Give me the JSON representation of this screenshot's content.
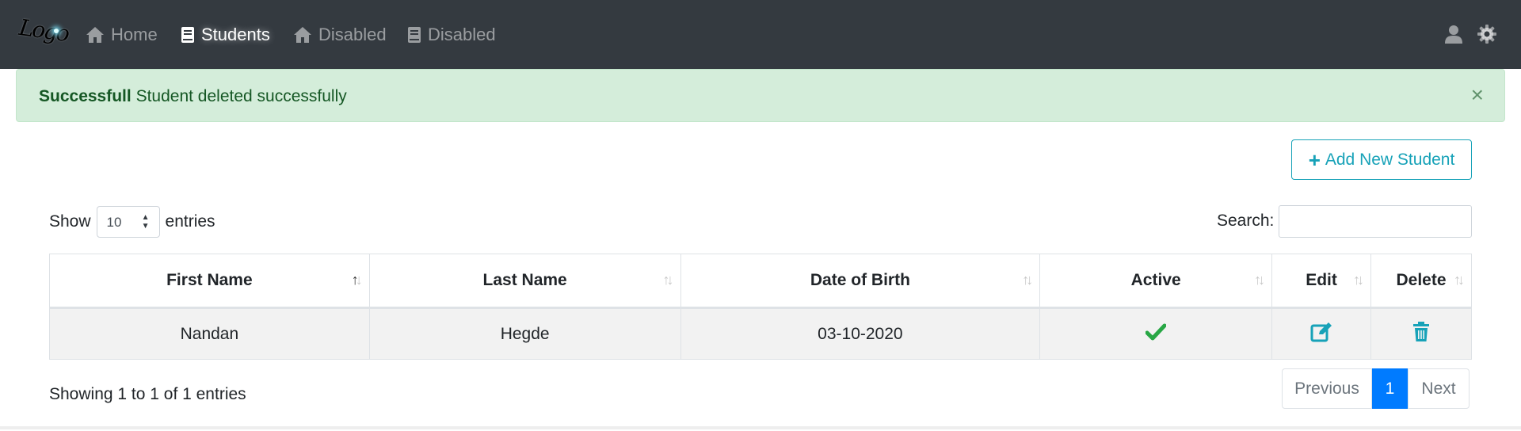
{
  "navbar": {
    "logo_text": "Logo",
    "items": [
      {
        "label": "Home",
        "icon": "home-icon",
        "active": false
      },
      {
        "label": "Students",
        "icon": "book-icon",
        "active": true
      },
      {
        "label": "Disabled",
        "icon": "home-icon",
        "active": false
      },
      {
        "label": "Disabled",
        "icon": "book-icon",
        "active": false
      }
    ],
    "right_icons": [
      "user-icon",
      "gear-icon"
    ]
  },
  "alert": {
    "title": "Successfull",
    "message": "Student deleted successfully",
    "close": "×",
    "color": "#155724",
    "background": "#d4edda"
  },
  "add_button": {
    "icon": "plus-icon",
    "label": "Add New Student",
    "color": "#17a2b8"
  },
  "length": {
    "show": "Show",
    "value": "10",
    "entries": "entries"
  },
  "search": {
    "label": "Search:",
    "value": ""
  },
  "table": {
    "columns": [
      "First Name",
      "Last Name",
      "Date of Birth",
      "Active",
      "Edit",
      "Delete"
    ],
    "sorted_column": "First Name",
    "sort_direction": "ascending",
    "rows": [
      {
        "first_name": "Nandan",
        "last_name": "Hegde",
        "dob": "03-10-2020",
        "active_icon": "check-icon",
        "edit_icon": "edit-icon",
        "delete_icon": "trash-icon"
      }
    ]
  },
  "footer": {
    "info": "Showing 1 to 1 of 1 entries",
    "previous": "Previous",
    "page": "1",
    "next": "Next"
  },
  "colors": {
    "navbar": "#343a40",
    "accent": "#17a2b8",
    "success": "#28a745",
    "primary": "#007bff"
  }
}
